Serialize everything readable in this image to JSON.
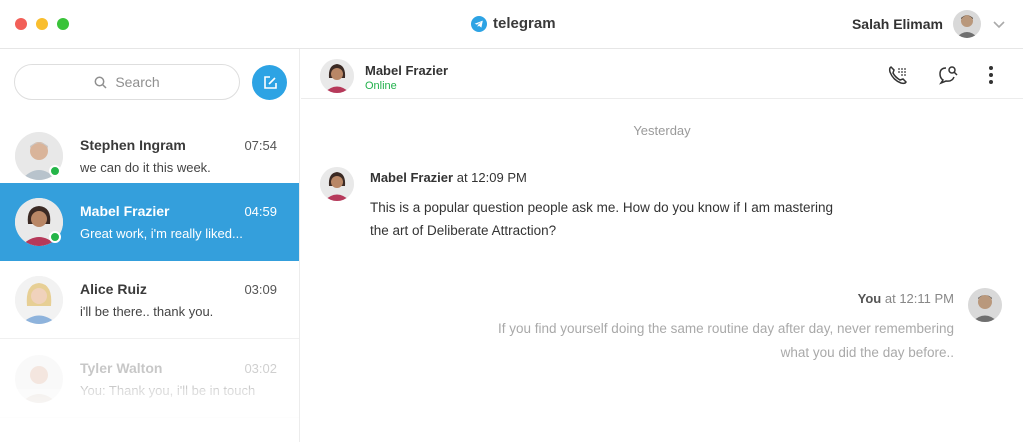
{
  "window": {
    "app_name": "telegram"
  },
  "user": {
    "name": "Salah Elimam"
  },
  "sidebar": {
    "search_placeholder": "Search",
    "chats": [
      {
        "name": "Stephen Ingram",
        "time": "07:54",
        "preview": "we can do it this week.",
        "online": true,
        "active": false
      },
      {
        "name": "Mabel Frazier",
        "time": "04:59",
        "preview": "Great work, i'm really liked...",
        "online": true,
        "active": true
      },
      {
        "name": "Alice Ruiz",
        "time": "03:09",
        "preview": "i'll be there.. thank you.",
        "online": false,
        "active": false
      },
      {
        "name": "Tyler Walton",
        "time": "03:02",
        "preview": "You: Thank you, i'll be in touch",
        "online": false,
        "active": false
      }
    ]
  },
  "conversation": {
    "contact_name": "Mabel Frazier",
    "contact_status": "Online",
    "day_label": "Yesterday",
    "messages": [
      {
        "sender": "Mabel Frazier",
        "at": "at 12:09 PM",
        "lines": [
          "This is a popular question people ask me. How do you know if I am mastering",
          "the art of Deliberate Attraction?"
        ]
      },
      {
        "sender": "You",
        "at": "at 12:11 PM",
        "lines": [
          "If you find yourself doing the same routine day after day, never remembering",
          "what you did the day before.."
        ]
      }
    ]
  },
  "colors": {
    "accent": "#2da3e4",
    "active_row": "#349fdc",
    "online": "#22b14c"
  }
}
